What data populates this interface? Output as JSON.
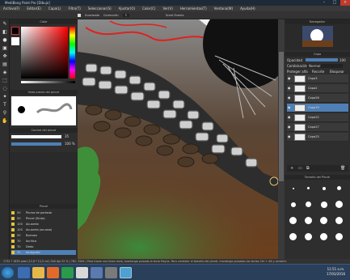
{
  "app_title": "MediBang Paint Pro [Dibujo]",
  "menu": [
    "Archivo(F)",
    "Editar(E)",
    "Capa(L)",
    "Filtro(T)",
    "Seleccionar(S)",
    "Ajustar(O)",
    "Color(C)",
    "Ver(V)",
    "Herramientas(T)",
    "Ventana(W)",
    "Ayuda(H)"
  ],
  "tool_options": {
    "smooth_label": "Suavizado",
    "correction_label": "Corrección",
    "correction_value": "5",
    "scroll_label": "Scroll Events"
  },
  "panels": {
    "color": "Color",
    "brush_preview": "Vista previa del pincel",
    "brush_control": "Control del pincel",
    "brush_list": "Pincel",
    "navigator": "Navegador",
    "layers": "Capa",
    "brush_size": "Tamaño del Pincel"
  },
  "brush_control": {
    "size": "35",
    "opacity": "100 %"
  },
  "brushes": [
    {
      "num": "50",
      "name": "Pluma de portada"
    },
    {
      "num": "50",
      "name": "Pincel (Sinta)"
    },
    {
      "num": "100",
      "name": "Acuarela"
    },
    {
      "num": "100",
      "name": "Acuarela (acuoso)"
    },
    {
      "num": "50",
      "name": "Borrosa"
    },
    {
      "num": "70",
      "name": "Acrílico"
    },
    {
      "num": "70",
      "name": "Dedo"
    },
    {
      "num": "35",
      "name": "Aerógrafo"
    }
  ],
  "layers_panel": {
    "opacity_label": "Opacidad",
    "opacity_value": "100",
    "blend_label": "Combinación",
    "blend_value": "Normal",
    "protect_alpha": "Proteger alfa",
    "clip": "Recorte",
    "lock": "Bloquear"
  },
  "layers": [
    "Capa3",
    "Capa2",
    "Capa26",
    "Capa19",
    "Capa22",
    "Capa27",
    "Capa25"
  ],
  "selected_layer": "Capa19",
  "status": "1732 * 1839 pixel  (12,6 * 15,5 cm)  300 dpi  25 %  ( 782, 3584 )  Para trazar una línea recta, mantenga pulsada la tecla Mayús. Para controlar el tamaño del pincel, mantenga pulsadas las teclas Ctrl + Alt y arrastre.",
  "clock": {
    "time": "11:51 a.m.",
    "date": "17/03/2016"
  },
  "colors": {
    "primary": "#000000",
    "secondary": "#ffffff",
    "accent": "#4f7fb5"
  }
}
